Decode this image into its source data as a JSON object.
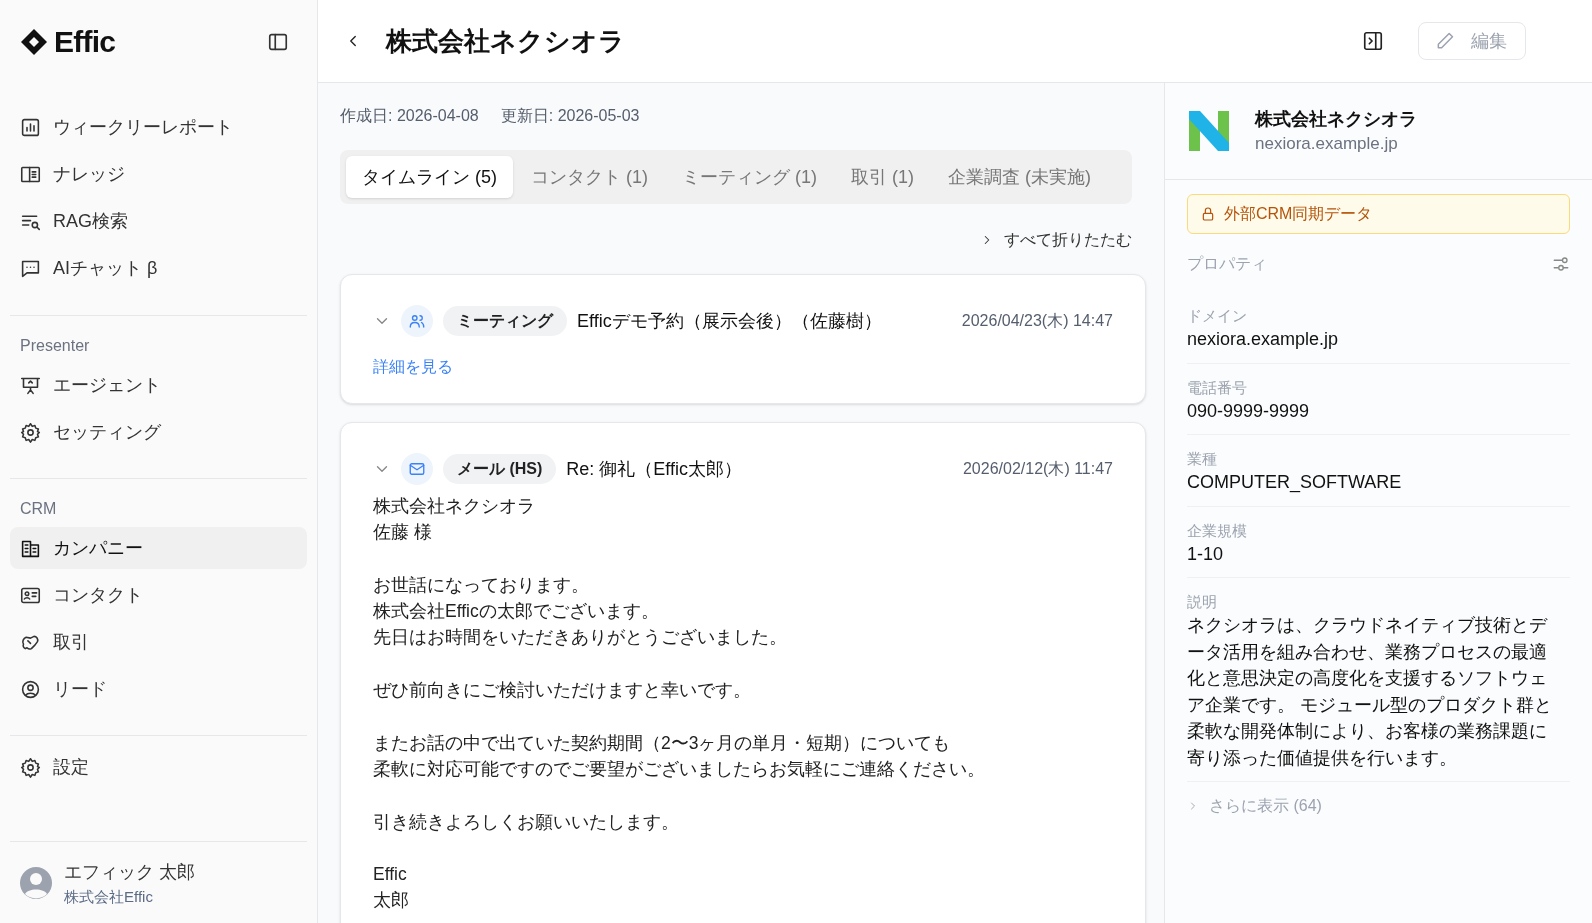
{
  "sidebar": {
    "logo": "Effic",
    "sections": [
      {
        "items": [
          {
            "label": "ウィークリーレポート",
            "selected": false
          },
          {
            "label": "ナレッジ",
            "selected": false
          },
          {
            "label": "RAG検索",
            "selected": false
          },
          {
            "label": "AIチャット β",
            "selected": false
          }
        ]
      },
      {
        "heading": "Presenter",
        "items": [
          {
            "label": "エージェント",
            "selected": false
          },
          {
            "label": "セッティング",
            "selected": false
          }
        ]
      },
      {
        "heading": "CRM",
        "items": [
          {
            "label": "カンパニー",
            "selected": true
          },
          {
            "label": "コンタクト",
            "selected": false
          },
          {
            "label": "取引",
            "selected": false
          },
          {
            "label": "リード",
            "selected": false
          }
        ]
      },
      {
        "items": [
          {
            "label": "設定",
            "selected": false
          }
        ]
      }
    ],
    "user": {
      "name": "エフィック 太郎",
      "company": "株式会社Effic"
    }
  },
  "header": {
    "title": "株式会社ネクシオラ",
    "edit_button": "編集"
  },
  "dates": [
    "作成日: 2026-04-08",
    "更新日: 2026-05-03"
  ],
  "tabs": [
    {
      "label": "タイムライン (5)",
      "selected": true
    },
    {
      "label": "コンタクト (1)",
      "selected": false
    },
    {
      "label": "ミーティング (1)",
      "selected": false
    },
    {
      "label": "取引 (1)",
      "selected": false
    },
    {
      "label": "企業調査 (未実施)",
      "selected": false
    }
  ],
  "collapse_all": "すべて折りたたむ",
  "timeline": [
    {
      "kind": "meeting",
      "tag": "ミーティング",
      "title": "Efficデモ予約（展示会後）（佐藤樹）",
      "datetime": "2026/04/23(木) 14:47",
      "link": "詳細を見る"
    },
    {
      "kind": "email",
      "tag": "メール (HS)",
      "title": "Re: 御礼（Effic太郎）",
      "datetime": "2026/02/12(木) 11:47",
      "body": [
        [
          "株式会社ネクシオラ",
          "佐藤 様"
        ],
        [
          "お世話になっております。",
          "株式会社Efficの太郎でございます。",
          "先日はお時間をいただきありがとうございました。"
        ],
        [
          "ぜひ前向きにご検討いただけますと幸いです。"
        ],
        [
          "またお話の中で出ていた契約期間（2〜3ヶ月の単月・短期）についても",
          "柔軟に対応可能ですのでご要望がございましたらお気軽にご連絡ください。"
        ],
        [
          "引き続きよろしくお願いいたします。"
        ],
        [
          "Effic",
          "太郎"
        ]
      ]
    }
  ],
  "company": {
    "name": "株式会社ネクシオラ",
    "domain": "nexiora.example.jp"
  },
  "notice": "外部CRM同期データ",
  "properties": {
    "heading": "プロパティ",
    "fields": [
      {
        "label": "ドメイン",
        "value": "nexiora.example.jp"
      },
      {
        "label": "電話番号",
        "value": "090-9999-9999"
      },
      {
        "label": "業種",
        "value": "COMPUTER_SOFTWARE"
      },
      {
        "label": "企業規模",
        "value": "1-10"
      },
      {
        "label": "説明",
        "value": "ネクシオラは、クラウドネイティブ技術とデータ活用を組み合わせ、業務プロセスの最適化と意思決定の高度化を支援するソフトウェア企業です。 モジュール型のプロダクト群と柔軟な開発体制により、お客様の業務課題に寄り添った価値提供を行います。"
      }
    ],
    "more": "さらに表示 (64)"
  }
}
